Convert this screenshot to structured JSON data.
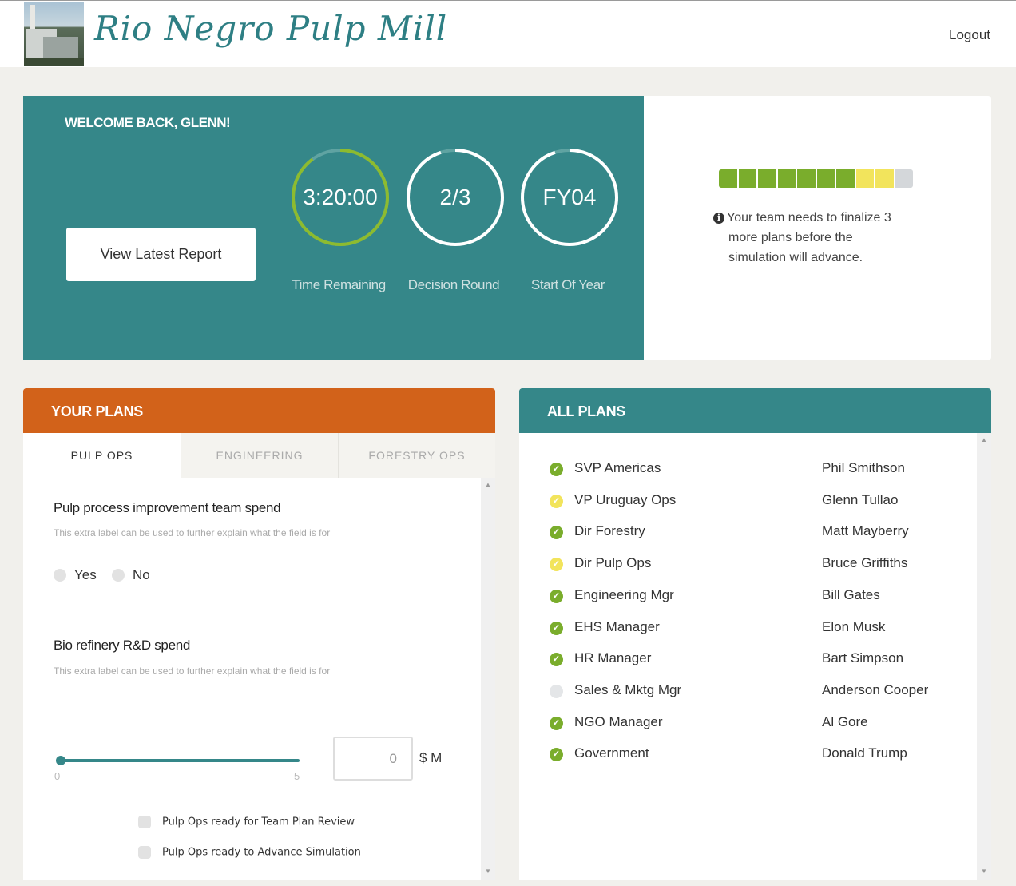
{
  "header": {
    "title": "Rio Negro Pulp Mill",
    "logout_label": "Logout"
  },
  "welcome": {
    "greeting": "WELCOME BACK, GLENN!",
    "report_button": "View Latest Report",
    "dials": [
      {
        "value": "3:20:00",
        "label": "Time Remaining",
        "progress": 0.9
      },
      {
        "value": "2/3",
        "label": "Decision Round",
        "progress": 0.95
      },
      {
        "value": "FY04",
        "label": "Start Of Year",
        "progress": 0.95
      }
    ]
  },
  "status": {
    "progress_segments": [
      "green",
      "green",
      "green",
      "green",
      "green",
      "green",
      "green",
      "yellow",
      "yellow",
      "gray"
    ],
    "note_line1": "Your team needs to finalize 3",
    "note_line2": "more plans before the",
    "note_line3": "simulation will advance."
  },
  "your_plans": {
    "heading": "YOUR PLANS",
    "tabs": [
      "PULP OPS",
      "ENGINEERING",
      "FORESTRY OPS"
    ],
    "active_tab": 0,
    "field1": {
      "title": "Pulp process improvement team spend",
      "help": "This extra label can be used to further explain what the field is for",
      "options": [
        "Yes",
        "No"
      ]
    },
    "field2": {
      "title": "Bio refinery R&D spend",
      "help": "This extra label can be used to further explain what the field is for",
      "slider_min": "0",
      "slider_max": "5",
      "slider_value": 0,
      "input_value": "0",
      "unit": "$ M"
    },
    "checks": [
      "Pulp Ops ready for Team Plan Review",
      "Pulp Ops ready to Advance Simulation"
    ]
  },
  "all_plans": {
    "heading": "ALL PLANS",
    "rows": [
      {
        "role": "SVP Americas",
        "person": "Phil Smithson",
        "status": "done"
      },
      {
        "role": "VP Uruguay Ops",
        "person": "Glenn Tullao",
        "status": "partial"
      },
      {
        "role": "Dir Forestry",
        "person": "Matt Mayberry",
        "status": "done"
      },
      {
        "role": "Dir Pulp Ops",
        "person": "Bruce Griffiths",
        "status": "partial"
      },
      {
        "role": "Engineering Mgr",
        "person": "Bill Gates",
        "status": "done"
      },
      {
        "role": "EHS Manager",
        "person": "Elon Musk",
        "status": "done"
      },
      {
        "role": "HR Manager",
        "person": "Bart Simpson",
        "status": "done"
      },
      {
        "role": "Sales & Mktg Mgr",
        "person": "Anderson Cooper",
        "status": "none"
      },
      {
        "role": "NGO Manager",
        "person": "Al Gore",
        "status": "done"
      },
      {
        "role": "Government",
        "person": "Donald Trump",
        "status": "done"
      }
    ]
  },
  "colors": {
    "teal": "#358789",
    "orange": "#d2621a",
    "green": "#7aad2c",
    "yellow": "#f2e45c",
    "gray": "#d4d7da"
  },
  "icons": {
    "info": "info-icon",
    "check": "check-icon"
  }
}
